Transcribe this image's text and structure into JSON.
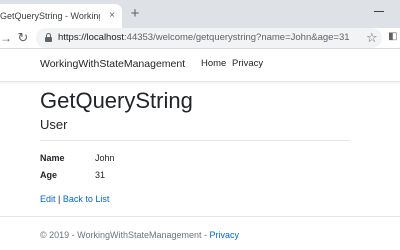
{
  "browser": {
    "tab_title": "GetQueryString - WorkingWithSt",
    "tab_close_glyph": "×",
    "new_tab_glyph": "+",
    "url_host": "https://localhost",
    "url_rest": ":44353/welcome/getquerystring?name=John&age=31"
  },
  "navbar": {
    "brand": "WorkingWithStateManagement",
    "links": [
      "Home",
      "Privacy"
    ]
  },
  "main": {
    "title": "GetQueryString",
    "subtitle": "User",
    "details": [
      {
        "label": "Name",
        "value": "John"
      },
      {
        "label": "Age",
        "value": "31"
      }
    ],
    "edit_link": "Edit",
    "separator": " | ",
    "back_link": "Back to List"
  },
  "footer": {
    "text": "© 2019 - WorkingWithStateManagement - ",
    "privacy_link": "Privacy"
  },
  "colors": {
    "link": "#0366d6",
    "text": "#212529",
    "muted": "#6c757d",
    "tabstrip": "#dee1e6",
    "omnibox": "#f1f3f4"
  },
  "icons": [
    "close-icon",
    "plus-icon",
    "reload-icon",
    "lock-icon",
    "star-icon",
    "extension-icon",
    "minimize-icon"
  ]
}
